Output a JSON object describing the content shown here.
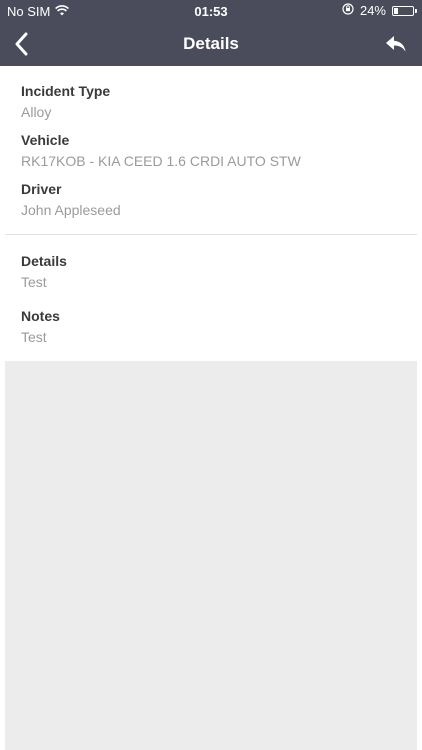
{
  "status_bar": {
    "carrier": "No SIM",
    "time": "01:53",
    "battery_percent": "24%",
    "battery_level": 0.24
  },
  "nav": {
    "title": "Details",
    "back_icon": "chevron-left-icon",
    "reply_icon": "reply-arrow-icon"
  },
  "incident": {
    "incident_type_label": "Incident Type",
    "incident_type_value": "Alloy",
    "vehicle_label": "Vehicle",
    "vehicle_value": "RK17KOB - KIA CEED 1.6 CRDI AUTO STW",
    "driver_label": "Driver",
    "driver_value": "John Appleseed"
  },
  "description": {
    "details_label": "Details",
    "details_value": "Test",
    "notes_label": "Notes",
    "notes_value": "Test"
  },
  "colors": {
    "nav_background": "#4a4b5b",
    "label_text": "#3a3a3a",
    "value_text": "#9b9b9b",
    "empty_area": "#ececec"
  }
}
